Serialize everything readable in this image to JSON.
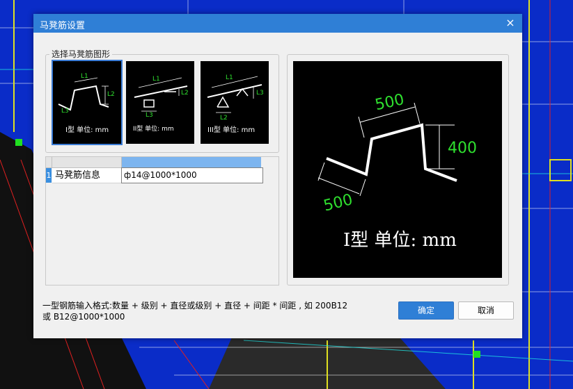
{
  "dialog": {
    "title": "马凳筋设置",
    "close_glyph": "×",
    "group_title": "选择马凳筋图形"
  },
  "shapes": [
    {
      "caption": "I型 单位: mm",
      "labels": [
        "L1",
        "L2",
        "L3"
      ],
      "selected": true
    },
    {
      "caption": "II型 单位: mm",
      "labels": [
        "L1",
        "L2",
        "L3"
      ],
      "selected": false
    },
    {
      "caption": "III型 单位: mm",
      "labels": [
        "L1",
        "L2",
        "L3"
      ],
      "selected": false
    }
  ],
  "grid": {
    "row_number": "1",
    "row_label": "马凳筋信息",
    "row_value": "ф14@1000*1000"
  },
  "preview": {
    "dim_top": "500",
    "dim_right": "400",
    "dim_left": "500",
    "caption": "I型 单位: mm"
  },
  "hint": {
    "line1": "一型钢筋输入格式:数量 + 级别 + 直径或级别 + 直径 + 间距 * 间距 , 如 200B12",
    "line2": "或 B12@1000*1000"
  },
  "buttons": {
    "ok": "确定",
    "cancel": "取消"
  },
  "colors": {
    "accent": "#2f7fd6",
    "dimension_text": "#2fe02f",
    "cad_background": "#0a2cc8"
  }
}
